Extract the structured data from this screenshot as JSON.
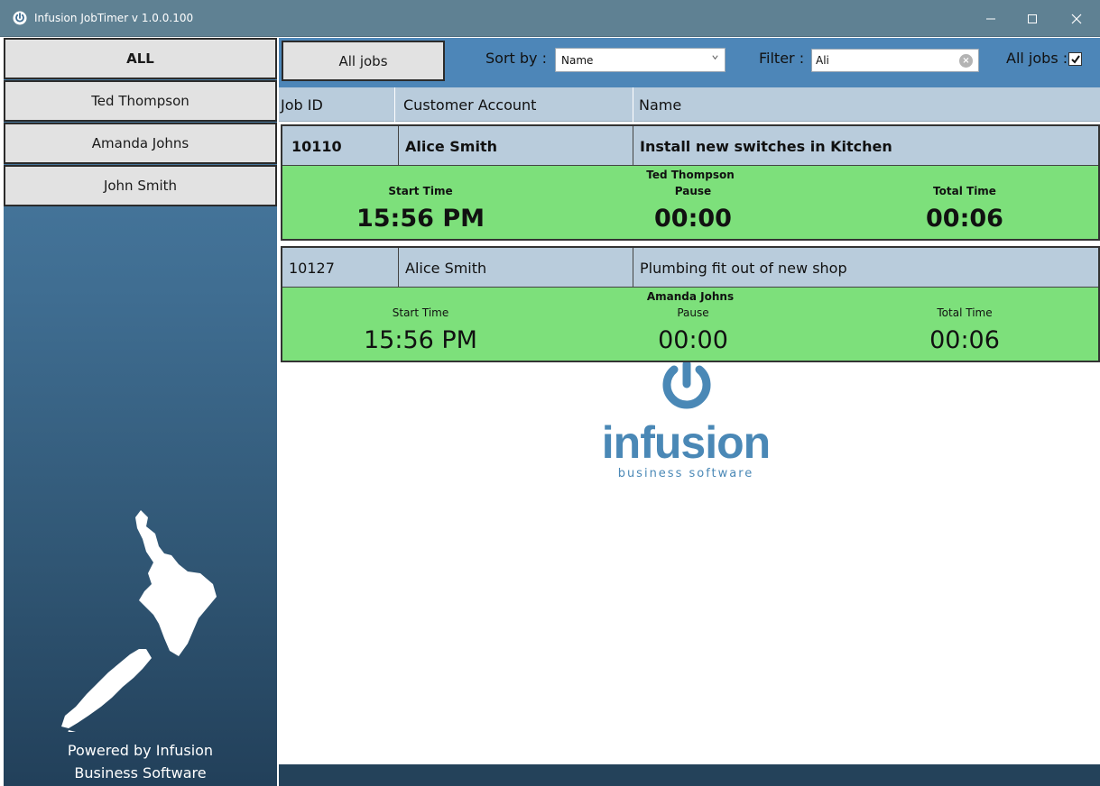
{
  "window": {
    "title": "Infusion JobTimer v 1.0.0.100"
  },
  "sidebar": {
    "employees": [
      {
        "label": "ALL"
      },
      {
        "label": "Ted Thompson"
      },
      {
        "label": "Amanda Johns"
      },
      {
        "label": "John Smith"
      }
    ],
    "powered_line1": "Powered by Infusion",
    "powered_line2": "Business Software"
  },
  "toolbar": {
    "all_jobs_button": "All jobs",
    "sort_label": "Sort by :",
    "sort_value": "Name",
    "filter_label": "Filter :",
    "filter_value": "Ali",
    "all_jobs_label": "All jobs :",
    "all_jobs_checked": true
  },
  "columns": {
    "job_id": "Job ID",
    "customer": "Customer Account",
    "name": "Name"
  },
  "jobs": [
    {
      "job_id": "10110",
      "customer": "Alice Smith",
      "name": "Install new switches in Kitchen",
      "technician": "Ted Thompson",
      "start_label": "Start Time",
      "start_value": "15:56 PM",
      "pause_label": "Pause",
      "pause_value": "00:00",
      "total_label": "Total Time",
      "total_value": "00:06",
      "selected": true
    },
    {
      "job_id": "10127",
      "customer": "Alice Smith",
      "name": "Plumbing fit out of new shop",
      "technician": "Amanda Johns",
      "start_label": "Start Time",
      "start_value": "15:56 PM",
      "pause_label": "Pause",
      "pause_value": "00:00",
      "total_label": "Total Time",
      "total_value": "00:06",
      "selected": false
    }
  ],
  "logo": {
    "word": "infusion",
    "tagline": "business software"
  },
  "colors": {
    "titlebar": "#5f8193",
    "toolbar": "#4d86b8",
    "header": "#b9ccdc",
    "timer_green": "#7de07b",
    "logo_blue": "#4a88b6",
    "footer": "#24425a"
  },
  "icons": {
    "app": "power-icon",
    "minimize": "minimize-icon",
    "maximize": "maximize-icon",
    "close": "close-icon",
    "dropdown": "chevron-down-icon",
    "clear": "clear-icon",
    "check": "checkmark-icon"
  }
}
